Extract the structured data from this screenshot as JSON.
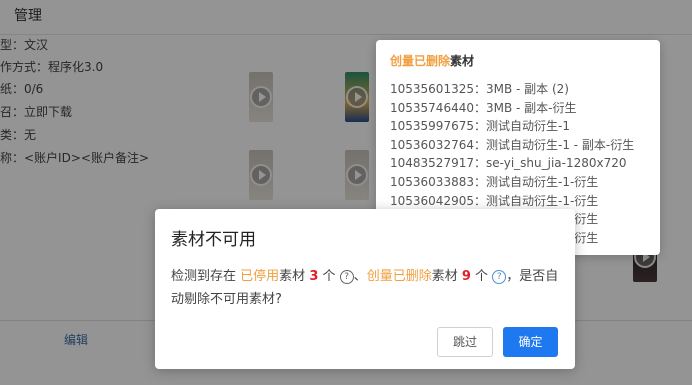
{
  "header": {
    "title": "管理"
  },
  "task_info": {
    "row1": "型：文汉",
    "row2": "作方式：程序化3.0",
    "row3": "纸：0/6",
    "row4": "召：立即下载",
    "row5": "类：无",
    "row6": "称：<账户ID><账户备注>"
  },
  "footer": {
    "edit_label": "编辑"
  },
  "popover": {
    "title_highlight": "创量已删除",
    "title_suffix": "素材",
    "items": [
      "10535601325：3MB - 副本 (2)",
      "10535746440：3MB - 副本-衍生",
      "10535997675：测试自动衍生-1",
      "10536032764：测试自动衍生-1 - 副本-衍生",
      "10483527917：se-yi_shu_jia-1280x720",
      "10536033883：测试自动衍生-1-衍生",
      "10536042905：测试自动衍生-1-衍生",
      "10536072443：测试自动衍生-1-衍生",
      "10536074330：测试自动衍生-1-衍生"
    ]
  },
  "dialog": {
    "title": "素材不可用",
    "text1": "检测到存在",
    "disabled_label": "已停用",
    "text2": "素材",
    "disabled_count": "3",
    "text3": "个",
    "text4": "、",
    "deleted_label": "创量已删除",
    "text5": "素材",
    "deleted_count": "9",
    "text6": "个",
    "text7": "，是否自动剔除不可用素材?",
    "help_icon": "?",
    "skip_label": "跳过",
    "ok_label": "确定"
  },
  "colors": {
    "accent_orange": "#f0a040",
    "count_red": "#e0202a",
    "primary_blue": "#1e78f0"
  }
}
